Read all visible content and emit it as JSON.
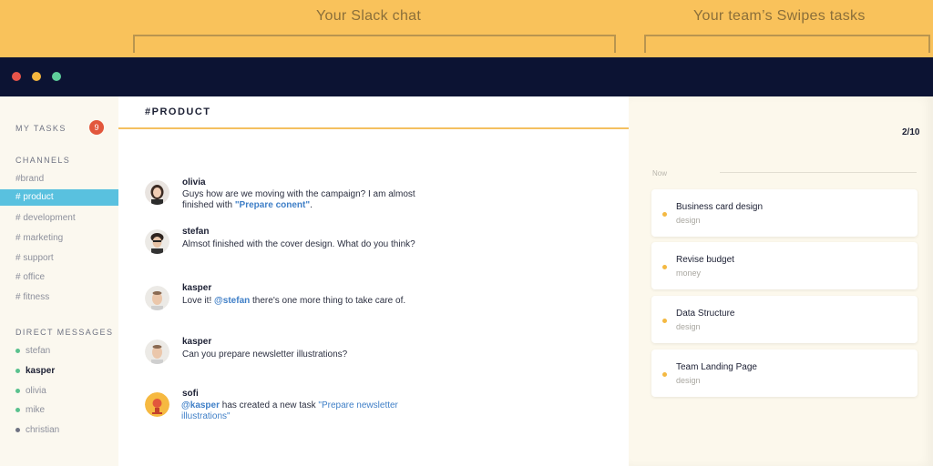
{
  "banner": {
    "chat_label": "Your Slack chat",
    "tasks_label": "Your team’s Swipes tasks"
  },
  "sidebar": {
    "my_tasks": "MY TASKS",
    "my_tasks_count": "9",
    "channels_heading": "CHANNELS",
    "channels": [
      "#brand",
      "# product",
      "# development",
      "# marketing",
      "# support",
      "# office",
      "# fitness"
    ],
    "dm_heading": "DIRECT MESSAGES",
    "dms": [
      "stefan",
      "kasper",
      "olivia",
      "mike",
      "christian"
    ]
  },
  "chat": {
    "channel_title": "#PRODUCT",
    "messages": [
      {
        "name": "olivia",
        "line1": "Guys how are we moving with the campaign? I am almost",
        "line2_prefix": "finished with ",
        "link": "\"Prepare conent\"",
        "line2_suffix": "."
      },
      {
        "name": "stefan",
        "text": "Almsot finished with the cover design. What do you think?"
      },
      {
        "name": "kasper",
        "prefix": "Love it! ",
        "mention": "@stefan",
        "suffix": " there's one more thing to take care of."
      },
      {
        "name": "kasper",
        "text": "Can you prepare newsletter illustrations?"
      },
      {
        "name": "sofi",
        "mention": "@kasper",
        "middle": " has created a new task ",
        "link1": "\"Prepare newsletter",
        "link2": "illustrations\""
      }
    ]
  },
  "tasks": {
    "counter": "2/10",
    "section": "Now",
    "cards": [
      {
        "title": "Business card design",
        "sub": "design"
      },
      {
        "title": "Revise budget",
        "sub": "money"
      },
      {
        "title": "Data Structure",
        "sub": "design"
      },
      {
        "title": "Team Landing Page",
        "sub": "design"
      }
    ]
  },
  "colors": {
    "banner": "#f9c25b",
    "titlebar": "#0c1333",
    "accent": "#59c1df",
    "badge": "#e2573c",
    "task_dot": "#f4b942",
    "presence_green": "#5ac18e",
    "presence_gray": "#6f7383"
  }
}
